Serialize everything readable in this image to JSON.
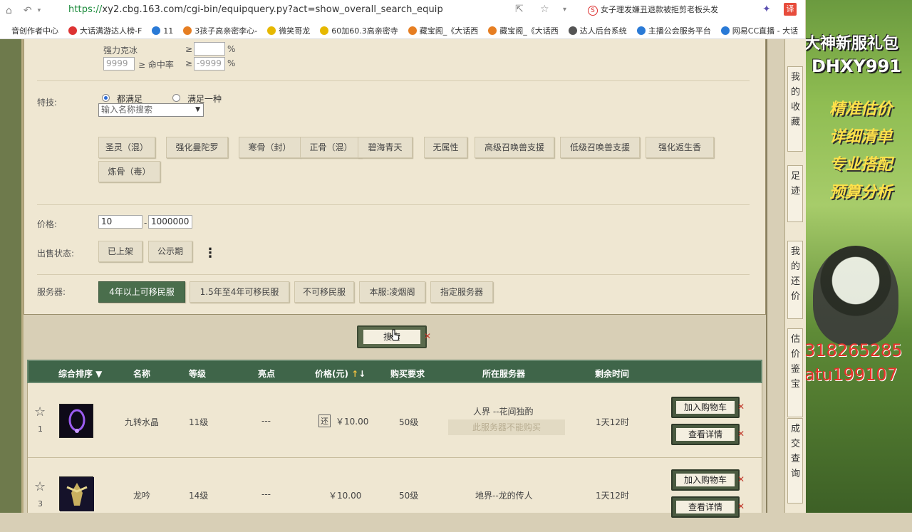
{
  "browser": {
    "url_proto": "https://",
    "url_rest": "xy2.cbg.163.com/cgi-bin/equipquery.py?act=show_overall_search_equip",
    "news": "女子理发嫌丑退款被拒剪老板头发",
    "translate": "译"
  },
  "bookmarks": [
    "音创作者中心",
    "大话满游达人榜-F",
    "11",
    "3孩子高亲密李心-",
    "微笑哥龙",
    "60加60.3高亲密寺",
    "藏宝阁_《大话西",
    "藏宝阁_《大话西",
    "达人后台系统",
    "主播公会服务平台",
    "网易CC直播 - 大话"
  ],
  "filters": {
    "stat1": "强力克冰",
    "ge1": "≥",
    "pct": "%",
    "val2": "9999",
    "stat2_mid": "≥ 命中率",
    "ge2": "≥",
    "val2b": "-9999",
    "skills_label": "特技:",
    "radio_all": "都满足",
    "radio_any": "满足一种",
    "skill_search_placeholder": "输入名称搜索",
    "skills": [
      "圣灵（混）",
      "强化曼陀罗",
      "寒骨（封）",
      "正骨（混）",
      "碧海青天",
      "无属性",
      "高级召唤兽支援",
      "低级召唤兽支援",
      "强化返生香",
      "炼骨（毒）"
    ],
    "price_label": "价格:",
    "price_min": "10",
    "price_dash": "-",
    "price_max": "1000000",
    "status_label": "出售状态:",
    "status_opts": [
      "已上架",
      "公示期"
    ],
    "more": "⋮",
    "server_label": "服务器:",
    "server_opts": [
      "4年以上可移民服",
      "1.5年至4年可移民服",
      "不可移民服",
      "本服:凌烟阁",
      "指定服务器"
    ]
  },
  "search_btn": "搜索",
  "table": {
    "headers": {
      "sort": "综合排序 ▼",
      "name": "名称",
      "level": "等级",
      "highlight": "亮点",
      "price": "价格(元)",
      "buy_req": "购买要求",
      "server": "所在服务器",
      "time": "剩余时间"
    },
    "rows": [
      {
        "idx": "1",
        "name": "九转水晶",
        "level": "11级",
        "highlight": "---",
        "price": "￥10.00",
        "tag": "还",
        "req": "50级",
        "server": "人界 --花间独酌",
        "note": "此服务器不能购买",
        "time": "1天12时"
      },
      {
        "idx": "3",
        "name": "龙吟",
        "level": "14级",
        "highlight": "---",
        "price": "￥10.00",
        "req": "50级",
        "server": "地界--龙的传人",
        "time": "1天12时"
      }
    ],
    "add_cart": "加入购物车",
    "details": "查看详情"
  },
  "side_tabs": [
    "我的收藏",
    "足迹",
    "我的还价",
    "估价鉴宝",
    "成交查询"
  ],
  "ad": {
    "l1": "大神新服礼包",
    "l2": "DHXY991",
    "l3": "精准估价",
    "l4": "详细清单",
    "l5": "专业搭配",
    "l6": "预算分析",
    "num": "318265285",
    "id": "atu199107"
  }
}
